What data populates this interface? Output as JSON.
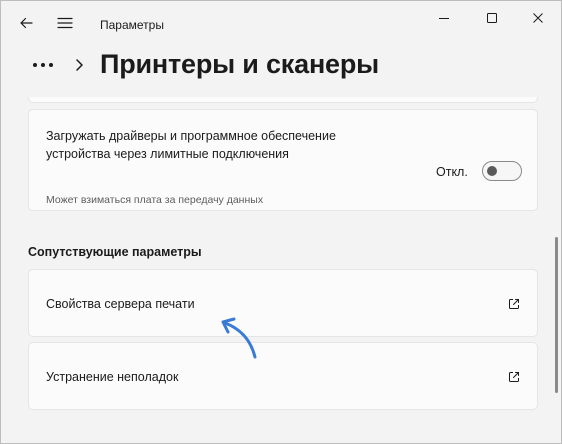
{
  "window": {
    "title": "Параметры"
  },
  "header": {
    "page_title": "Принтеры и сканеры"
  },
  "download_card": {
    "text": "Загружать драйверы и программное обеспечение устройства через лимитные подключения",
    "subtext": "Может взиматься плата за передачу данных",
    "toggle_label": "Откл.",
    "toggle_on": false
  },
  "related": {
    "heading": "Сопутствующие параметры",
    "items": [
      {
        "label": "Свойства сервера печати",
        "icon": "open-external-icon"
      },
      {
        "label": "Устранение неполадок",
        "icon": "open-external-icon"
      }
    ]
  },
  "colors": {
    "annotation_arrow": "#3a7bd5",
    "background": "#f3f3f3",
    "card": "#fbfbfb"
  }
}
